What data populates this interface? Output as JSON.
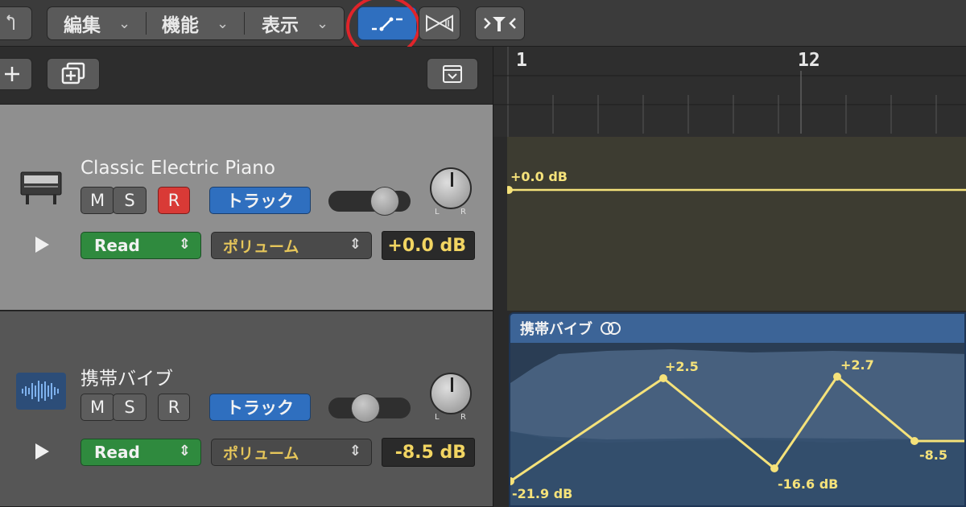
{
  "toolbar": {
    "menus": [
      {
        "label": "編集"
      },
      {
        "label": "機能"
      },
      {
        "label": "表示"
      }
    ]
  },
  "ruler": {
    "bar_start": "1",
    "bar_second": "12"
  },
  "tracks": [
    {
      "name": "Classic Electric Piano",
      "mute": "M",
      "solo": "S",
      "record": "R",
      "track_button": "トラック",
      "automation_mode": "Read",
      "automation_param": "ポリューム",
      "value": "+0.0 dB",
      "record_armed": true
    },
    {
      "name": "携帯バイブ",
      "mute": "M",
      "solo": "S",
      "record": "R",
      "track_button": "トラック",
      "automation_mode": "Read",
      "automation_param": "ポリューム",
      "value": "-8.5 dB",
      "record_armed": false
    }
  ],
  "pan_labels": {
    "left": "L",
    "right": "R"
  },
  "lane1": {
    "point_label": "+0.0 dB"
  },
  "region": {
    "title": "携帯バイブ",
    "point_labels": [
      "-21.9 dB",
      "+2.5",
      "-16.6 dB",
      "+2.7",
      "-8.5"
    ]
  },
  "colors": {
    "accent_blue": "#2f6fbf",
    "record_red": "#d93a36",
    "read_green": "#2f8a3e",
    "automation_yellow": "#f5e27a",
    "highlight_circle": "#e0242a"
  },
  "icons": [
    "back-arrow-icon",
    "automation-curve-icon",
    "flex-icon",
    "catch-icon",
    "add-track-icon",
    "duplicate-track-icon",
    "collapse-icon",
    "piano-icon",
    "waveform-icon",
    "play-icon",
    "loop-icon"
  ]
}
